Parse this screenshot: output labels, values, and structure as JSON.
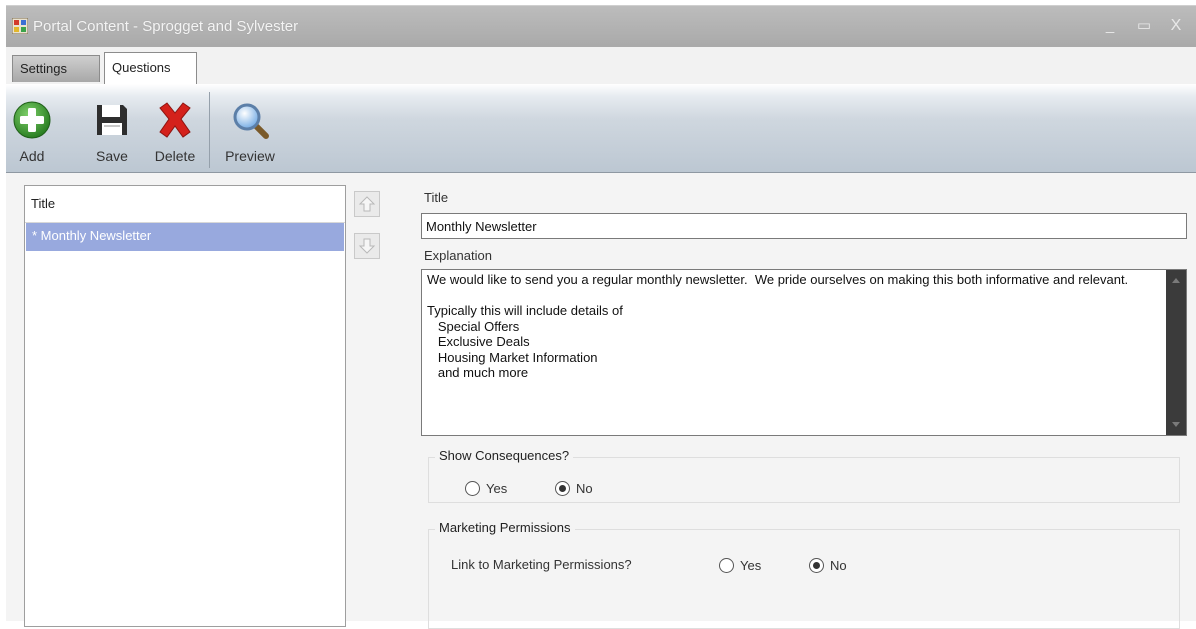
{
  "window": {
    "title": "Portal Content - Sprogget and Sylvester",
    "minimize": "_",
    "maximize": "▭",
    "close": "X"
  },
  "tabs": [
    {
      "label": "Settings",
      "selected": false
    },
    {
      "label": "Questions",
      "selected": true
    }
  ],
  "toolbar": {
    "add_label": "Add",
    "save_label": "Save",
    "delete_label": "Delete",
    "preview_label": "Preview"
  },
  "list": {
    "header": "Title",
    "items": [
      {
        "label": "* Monthly Newsletter",
        "selected": true
      }
    ]
  },
  "form": {
    "title_label": "Title",
    "title_value": "Monthly Newsletter",
    "explanation_label": "Explanation",
    "explanation_value": "We would like to send you a regular monthly newsletter.  We pride ourselves on making this both informative and relevant.\n\nTypically this will include details of\n   Special Offers\n   Exclusive Deals\n   Housing Market Information\n   and much more",
    "show_consequences": {
      "label": "Show Consequences?",
      "yes_label": "Yes",
      "no_label": "No",
      "selected": "No"
    },
    "marketing_permissions": {
      "group_label": "Marketing Permissions",
      "question_label": "Link to Marketing Permissions?",
      "yes_label": "Yes",
      "no_label": "No",
      "selected": "No"
    }
  },
  "colors": {
    "selection": "#98a9de",
    "add_icon": "#3c9a2e",
    "delete_icon": "#d0201a",
    "titlebar": "#b3b3b3"
  }
}
